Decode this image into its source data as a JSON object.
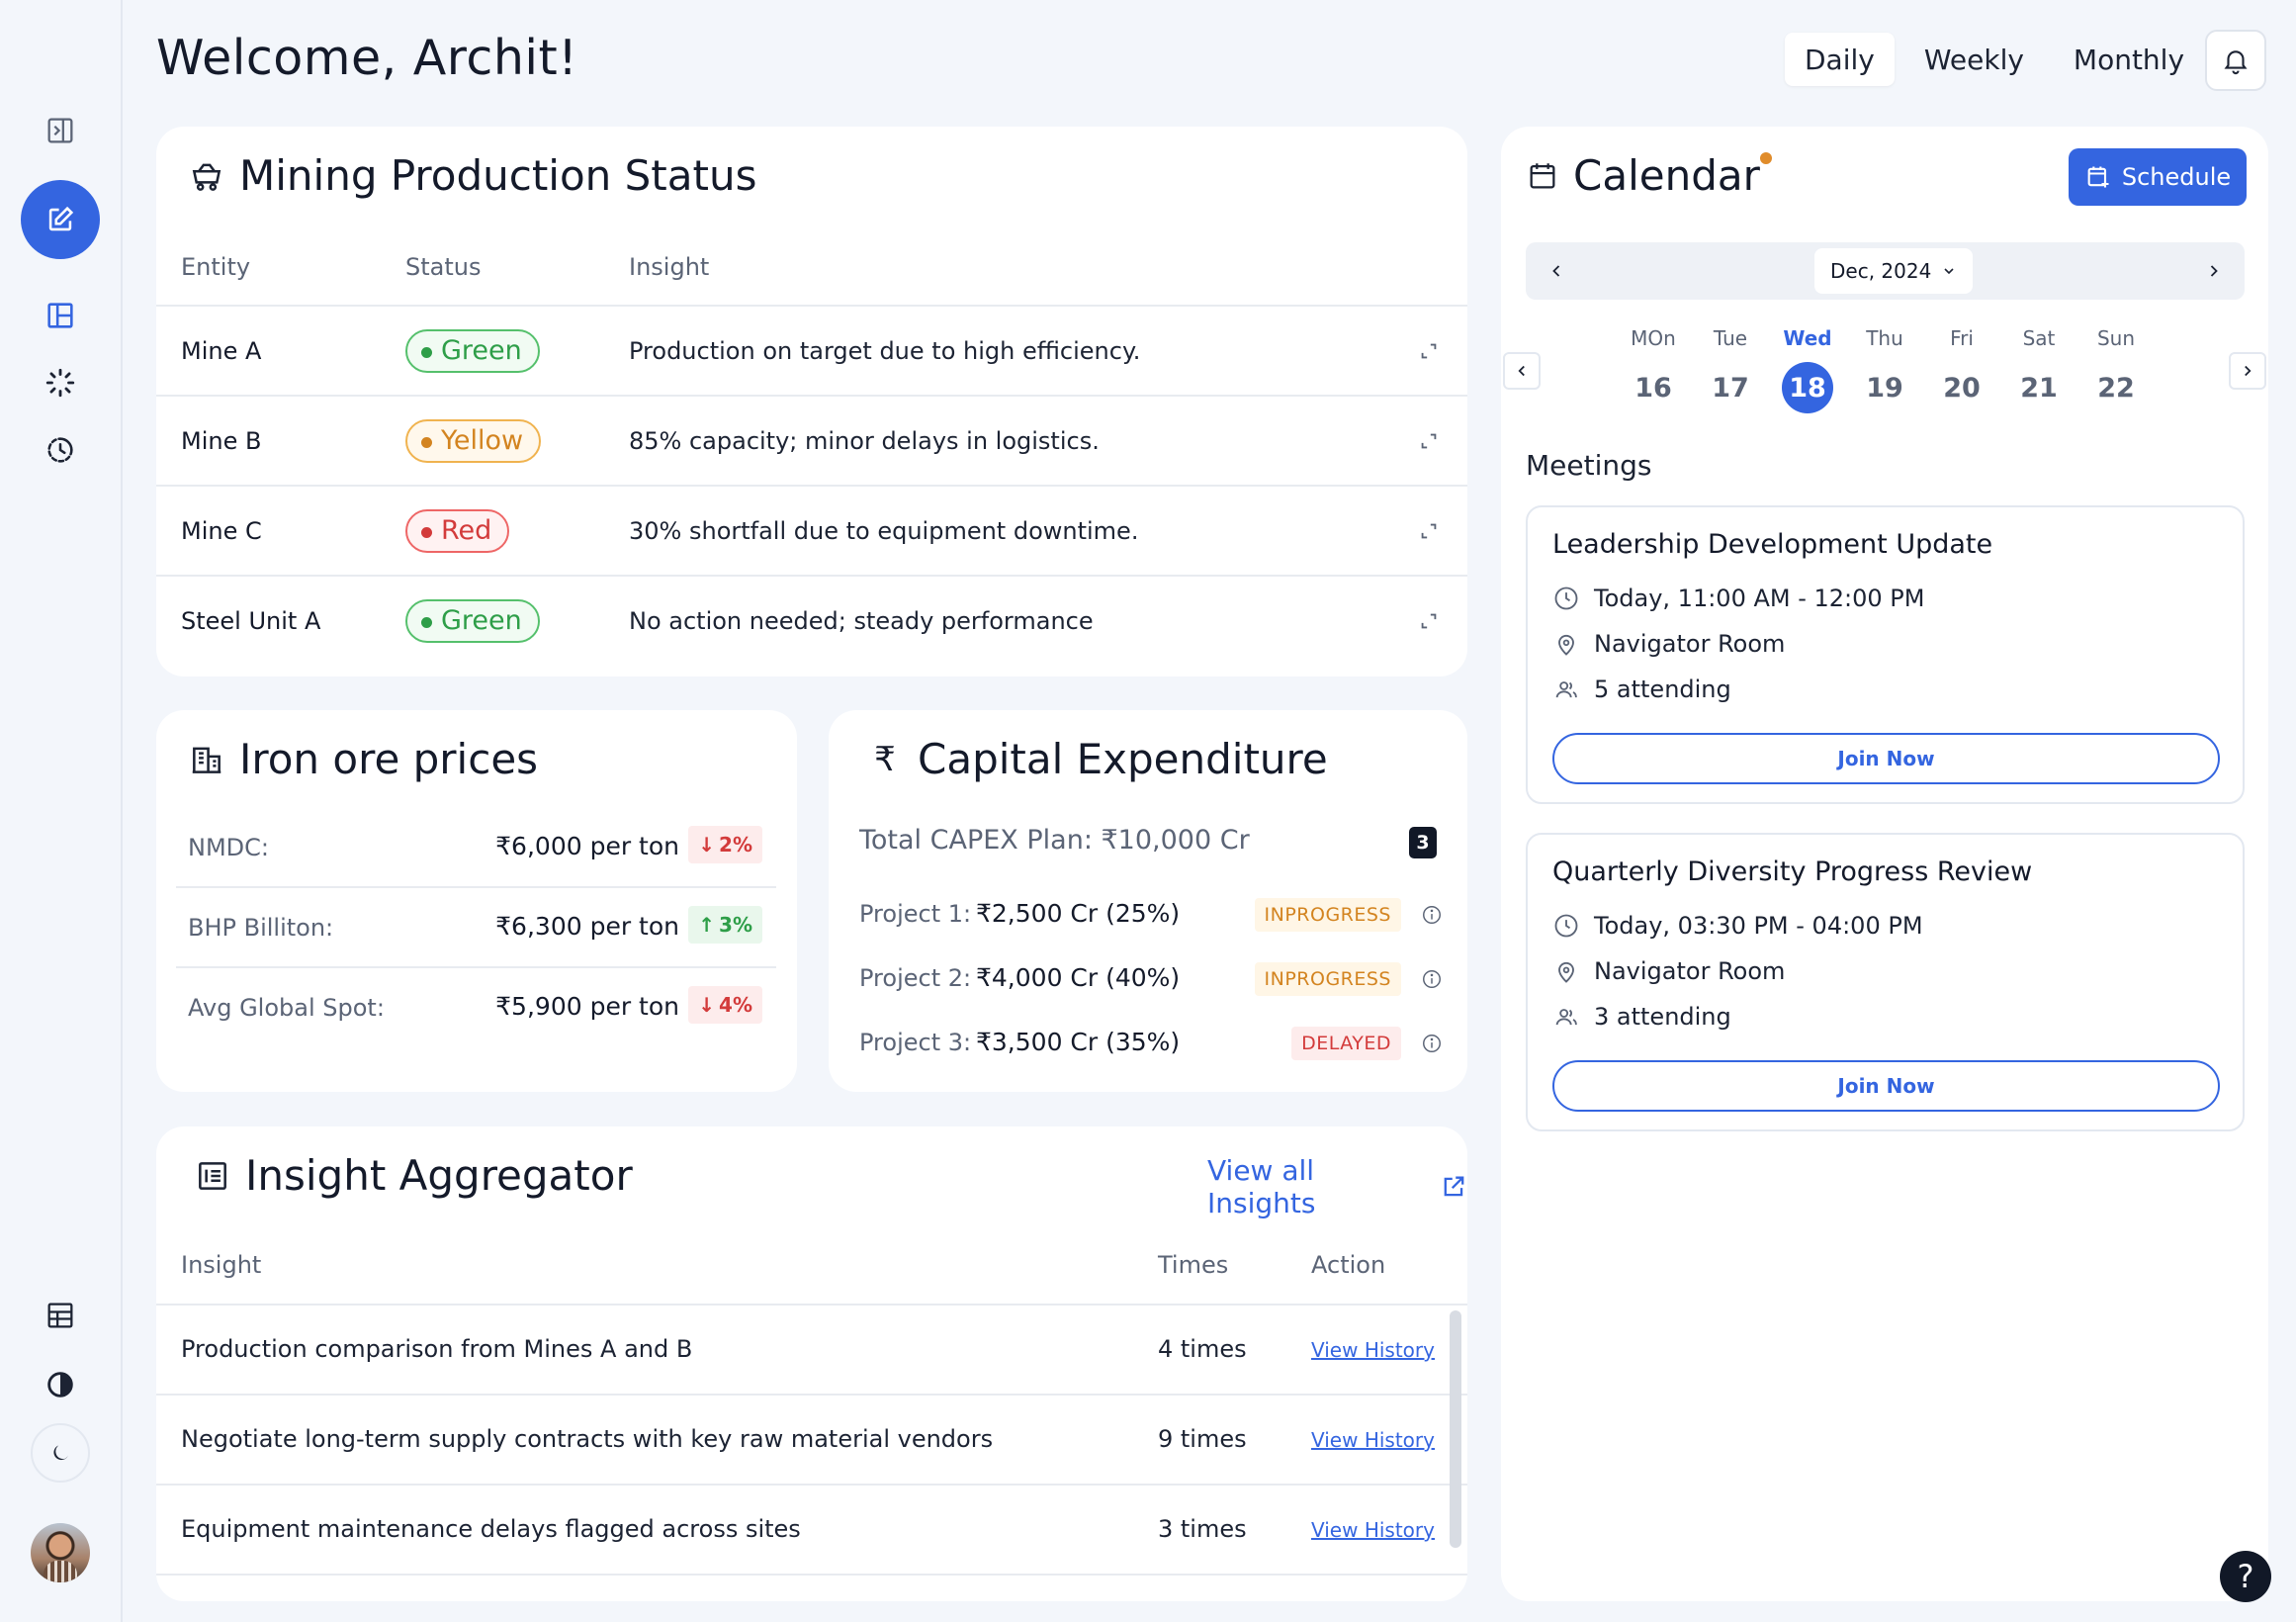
{
  "header": {
    "welcome": "Welcome, Archit!",
    "tabs": [
      "Daily",
      "Weekly",
      "Monthly"
    ],
    "active_tab": "Daily"
  },
  "mining": {
    "title": "Mining Production Status",
    "columns": [
      "Entity",
      "Status",
      "Insight"
    ],
    "rows": [
      {
        "entity": "Mine A",
        "status": "Green",
        "insight": "Production on target due to high efficiency."
      },
      {
        "entity": "Mine B",
        "status": "Yellow",
        "insight": "85% capacity; minor delays in logistics."
      },
      {
        "entity": "Mine C",
        "status": "Red",
        "insight": "30% shortfall due to equipment downtime."
      },
      {
        "entity": "Steel Unit A",
        "status": "Green",
        "insight": "No action needed; steady performance"
      }
    ]
  },
  "iron": {
    "title": "Iron ore prices",
    "rows": [
      {
        "name": "NMDC:",
        "price": "₹6,000 per ton",
        "change": "2%",
        "dir": "down"
      },
      {
        "name": "BHP Billiton:",
        "price": "₹6,300 per ton",
        "change": "3%",
        "dir": "up"
      },
      {
        "name": "Avg Global Spot:",
        "price": "₹5,900 per ton",
        "change": "4%",
        "dir": "down"
      }
    ]
  },
  "capex": {
    "title": "Capital Expenditure",
    "total": "Total CAPEX Plan: ₹10,000 Cr",
    "count": "3",
    "projects": [
      {
        "label": "Project 1:",
        "value": "₹2,500 Cr (25%)",
        "status": "INPROGRESS"
      },
      {
        "label": "Project 2:",
        "value": "₹4,000 Cr (40%)",
        "status": "INPROGRESS"
      },
      {
        "label": "Project 3:",
        "value": "₹3,500 Cr (35%)",
        "status": "DELAYED"
      }
    ]
  },
  "insights": {
    "title": "Insight Aggregator",
    "view_all": "View all Insights",
    "columns": [
      "Insight",
      "Times",
      "Action"
    ],
    "rows": [
      {
        "text": "Production comparison from Mines A and B",
        "times": "4 times",
        "action": "View History"
      },
      {
        "text": "Negotiate long-term supply contracts with key raw material vendors",
        "times": "9 times",
        "action": "View History"
      },
      {
        "text": "Equipment maintenance delays flagged across sites",
        "times": "3 times",
        "action": "View History"
      }
    ]
  },
  "calendar": {
    "title": "Calendar",
    "schedule_label": "Schedule",
    "month": "Dec, 2024",
    "days": [
      {
        "name": "MOn",
        "date": "16"
      },
      {
        "name": "Tue",
        "date": "17"
      },
      {
        "name": "Wed",
        "date": "18",
        "selected": true
      },
      {
        "name": "Thu",
        "date": "19"
      },
      {
        "name": "Fri",
        "date": "20"
      },
      {
        "name": "Sat",
        "date": "21"
      },
      {
        "name": "Sun",
        "date": "22"
      }
    ],
    "meetings_label": "Meetings",
    "meetings": [
      {
        "title": "Leadership Development Update",
        "time": "Today, 11:00 AM - 12:00 PM",
        "room": "Navigator Room",
        "attending": "5 attending",
        "join": "Join Now"
      },
      {
        "title": "Quarterly Diversity Progress Review",
        "time": "Today, 03:30 PM - 04:00 PM",
        "room": "Navigator Room",
        "attending": "3 attending",
        "join": "Join Now"
      }
    ]
  },
  "help": "?",
  "colors": {
    "accent": "#3465e0",
    "green": "#2e9e48",
    "yellow": "#d38420",
    "red": "#d33b3b"
  }
}
